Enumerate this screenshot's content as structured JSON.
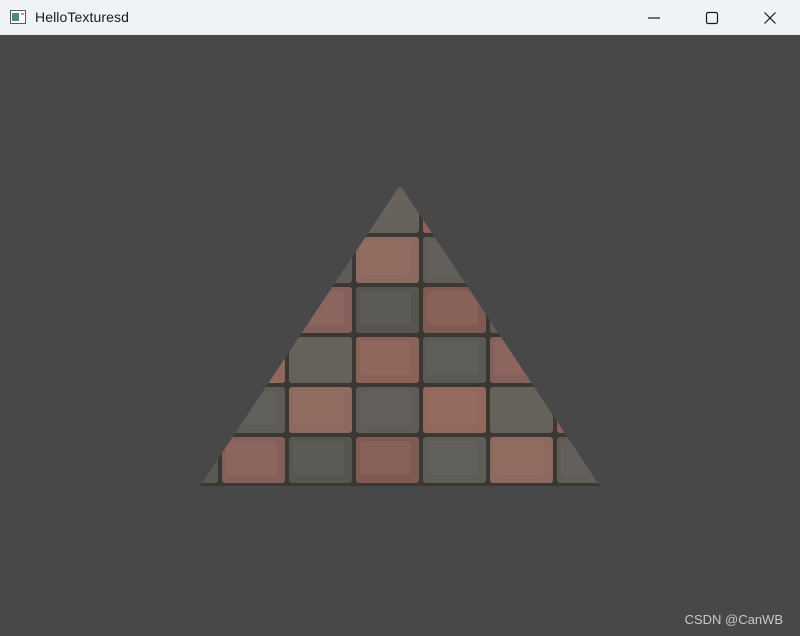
{
  "window": {
    "title": "HelloTexturesd",
    "controls": {
      "minimize": "minimize",
      "maximize": "maximize",
      "close": "close"
    }
  },
  "viewport": {
    "clear_color": "#484848"
  },
  "watermark": {
    "text": "CSDN @CanWB"
  },
  "icons": {
    "app": "app-window-icon",
    "minimize": "minimize-icon",
    "maximize": "maximize-icon",
    "close": "close-icon"
  },
  "colors": {
    "titlebar": "#eff3f8",
    "background": "#484848",
    "tile_gray": "#5f5c55",
    "tile_red": "#8a6258",
    "grout": "#3b3833"
  }
}
